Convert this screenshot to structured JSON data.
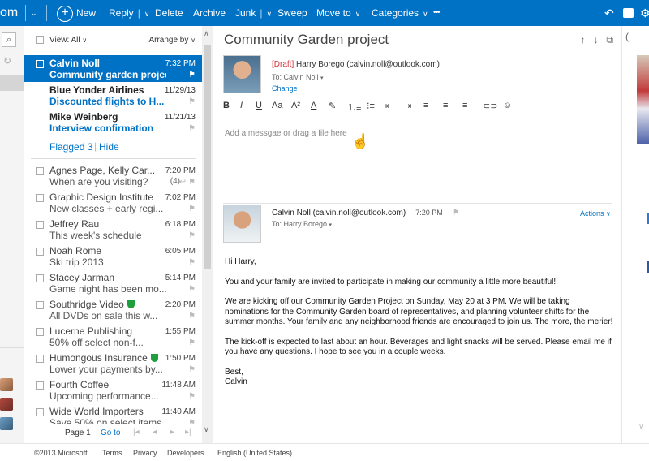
{
  "topbar": {
    "brand_fragment": "om",
    "new_label": "New",
    "reply_label": "Reply",
    "delete_label": "Delete",
    "archive_label": "Archive",
    "junk_label": "Junk",
    "sweep_label": "Sweep",
    "moveto_label": "Move to",
    "categories_label": "Categories",
    "more_label": "•••",
    "icons": [
      "undo-icon",
      "chat-icon",
      "settings-icon"
    ],
    "accent": "#0072c6"
  },
  "list": {
    "view_label": "View: All",
    "arrange_label": "Arrange by",
    "pinned": [
      {
        "from": "Calvin Noll",
        "subject": "Community garden project",
        "time": "7:32 PM",
        "selected": true
      },
      {
        "from": "Blue Yonder Airlines",
        "subject": "Discounted flights to H...",
        "time": "11/29/13"
      },
      {
        "from": "Mike Weinberg",
        "subject": "Interview confirmation",
        "time": "11/21/13"
      }
    ],
    "flagged_label": "Flagged 3",
    "hide_label": "Hide",
    "messages": [
      {
        "from": "Agnes Page, Kelly Car...",
        "subject": "When are you visiting?",
        "time": "7:20 PM",
        "count": "(4)"
      },
      {
        "from": "Graphic Design Institute",
        "subject": "New classes + early regi...",
        "time": "7:02 PM"
      },
      {
        "from": "Jeffrey Rau",
        "subject": "This week's schedule",
        "time": "6:18 PM"
      },
      {
        "from": "Noah Rome",
        "subject": "Ski trip 2013",
        "time": "6:05 PM"
      },
      {
        "from": "Stacey Jarman",
        "subject": "Game night has been mo...",
        "time": "5:14 PM"
      },
      {
        "from": "Southridge Video",
        "subject": "All DVDs on sale this w...",
        "time": "2:20 PM",
        "verified": true
      },
      {
        "from": "Lucerne Publishing",
        "subject": "50% off select non-f...",
        "time": "1:55 PM"
      },
      {
        "from": "Humongous Insurance",
        "subject": "Lower your payments by...",
        "time": "1:50 PM",
        "verified": true
      },
      {
        "from": "Fourth Coffee",
        "subject": "Upcoming performance...",
        "time": "11:48 AM"
      },
      {
        "from": "Wide World Importers",
        "subject": "Save 50% on select items",
        "time": "11:40 AM"
      }
    ],
    "pager": {
      "page_label": "Page 1",
      "goto_label": "Go to"
    }
  },
  "reading": {
    "title": "Community Garden project",
    "draft_tag": "[Draft]",
    "draft_from": "Harry Borego (calvin.noll@outlook.com)",
    "draft_to": "To: Calvin Noll",
    "change_label": "Change",
    "format_tools": [
      "B",
      "I",
      "U",
      "Aa",
      "A²",
      "A",
      "pen",
      "list-num",
      "list-bullet",
      "outdent",
      "indent",
      "align-left",
      "align-center",
      "align-right",
      "link",
      "emoji"
    ],
    "compose_placeholder": "Add a messgae or drag a file here",
    "sender": "Calvin Noll (calvin.noll@outlook.com)",
    "sent_time": "7:20 PM",
    "to_line": "To: Harry Borego",
    "actions_label": "Actions",
    "greeting": "Hi Harry,",
    "p1": "You and your family are invited to participate in making our community a little more beautiful!",
    "p2": "We are kicking off our Community Garden Project on Sunday, May 20 at 3 PM. We will be taking nominations for the Community Garden board of representatives, and planning volunteer shifts for the summer months. Your family and any neighborhood friends are encouraged to join us. The more, the merier!",
    "p3": "The kick-off is expected to last about an hour. Beverages and light snacks will be served. Please email me if you have any questions. I hope to see you in a couple weeks.",
    "closing": "Best,",
    "signature": "Calvin"
  },
  "footer": {
    "copyright": "©2013 Microsoft",
    "terms": "Terms",
    "privacy": "Privacy",
    "developers": "Developers",
    "language": "English (United States)"
  }
}
